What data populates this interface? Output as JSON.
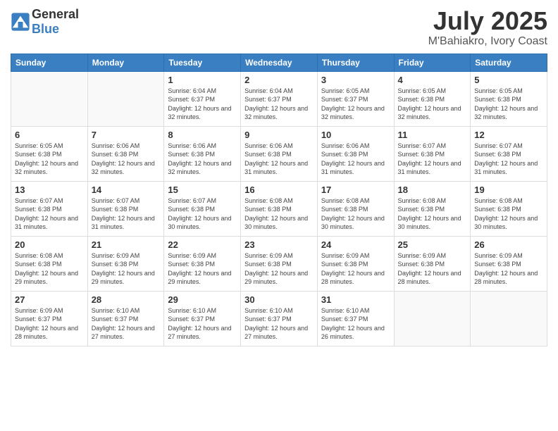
{
  "logo": {
    "general": "General",
    "blue": "Blue"
  },
  "title": "July 2025",
  "subtitle": "M'Bahiakro, Ivory Coast",
  "weekdays": [
    "Sunday",
    "Monday",
    "Tuesday",
    "Wednesday",
    "Thursday",
    "Friday",
    "Saturday"
  ],
  "weeks": [
    [
      {
        "day": "",
        "detail": ""
      },
      {
        "day": "",
        "detail": ""
      },
      {
        "day": "1",
        "detail": "Sunrise: 6:04 AM\nSunset: 6:37 PM\nDaylight: 12 hours and 32 minutes."
      },
      {
        "day": "2",
        "detail": "Sunrise: 6:04 AM\nSunset: 6:37 PM\nDaylight: 12 hours and 32 minutes."
      },
      {
        "day": "3",
        "detail": "Sunrise: 6:05 AM\nSunset: 6:37 PM\nDaylight: 12 hours and 32 minutes."
      },
      {
        "day": "4",
        "detail": "Sunrise: 6:05 AM\nSunset: 6:38 PM\nDaylight: 12 hours and 32 minutes."
      },
      {
        "day": "5",
        "detail": "Sunrise: 6:05 AM\nSunset: 6:38 PM\nDaylight: 12 hours and 32 minutes."
      }
    ],
    [
      {
        "day": "6",
        "detail": "Sunrise: 6:05 AM\nSunset: 6:38 PM\nDaylight: 12 hours and 32 minutes."
      },
      {
        "day": "7",
        "detail": "Sunrise: 6:06 AM\nSunset: 6:38 PM\nDaylight: 12 hours and 32 minutes."
      },
      {
        "day": "8",
        "detail": "Sunrise: 6:06 AM\nSunset: 6:38 PM\nDaylight: 12 hours and 32 minutes."
      },
      {
        "day": "9",
        "detail": "Sunrise: 6:06 AM\nSunset: 6:38 PM\nDaylight: 12 hours and 31 minutes."
      },
      {
        "day": "10",
        "detail": "Sunrise: 6:06 AM\nSunset: 6:38 PM\nDaylight: 12 hours and 31 minutes."
      },
      {
        "day": "11",
        "detail": "Sunrise: 6:07 AM\nSunset: 6:38 PM\nDaylight: 12 hours and 31 minutes."
      },
      {
        "day": "12",
        "detail": "Sunrise: 6:07 AM\nSunset: 6:38 PM\nDaylight: 12 hours and 31 minutes."
      }
    ],
    [
      {
        "day": "13",
        "detail": "Sunrise: 6:07 AM\nSunset: 6:38 PM\nDaylight: 12 hours and 31 minutes."
      },
      {
        "day": "14",
        "detail": "Sunrise: 6:07 AM\nSunset: 6:38 PM\nDaylight: 12 hours and 31 minutes."
      },
      {
        "day": "15",
        "detail": "Sunrise: 6:07 AM\nSunset: 6:38 PM\nDaylight: 12 hours and 30 minutes."
      },
      {
        "day": "16",
        "detail": "Sunrise: 6:08 AM\nSunset: 6:38 PM\nDaylight: 12 hours and 30 minutes."
      },
      {
        "day": "17",
        "detail": "Sunrise: 6:08 AM\nSunset: 6:38 PM\nDaylight: 12 hours and 30 minutes."
      },
      {
        "day": "18",
        "detail": "Sunrise: 6:08 AM\nSunset: 6:38 PM\nDaylight: 12 hours and 30 minutes."
      },
      {
        "day": "19",
        "detail": "Sunrise: 6:08 AM\nSunset: 6:38 PM\nDaylight: 12 hours and 30 minutes."
      }
    ],
    [
      {
        "day": "20",
        "detail": "Sunrise: 6:08 AM\nSunset: 6:38 PM\nDaylight: 12 hours and 29 minutes."
      },
      {
        "day": "21",
        "detail": "Sunrise: 6:09 AM\nSunset: 6:38 PM\nDaylight: 12 hours and 29 minutes."
      },
      {
        "day": "22",
        "detail": "Sunrise: 6:09 AM\nSunset: 6:38 PM\nDaylight: 12 hours and 29 minutes."
      },
      {
        "day": "23",
        "detail": "Sunrise: 6:09 AM\nSunset: 6:38 PM\nDaylight: 12 hours and 29 minutes."
      },
      {
        "day": "24",
        "detail": "Sunrise: 6:09 AM\nSunset: 6:38 PM\nDaylight: 12 hours and 28 minutes."
      },
      {
        "day": "25",
        "detail": "Sunrise: 6:09 AM\nSunset: 6:38 PM\nDaylight: 12 hours and 28 minutes."
      },
      {
        "day": "26",
        "detail": "Sunrise: 6:09 AM\nSunset: 6:38 PM\nDaylight: 12 hours and 28 minutes."
      }
    ],
    [
      {
        "day": "27",
        "detail": "Sunrise: 6:09 AM\nSunset: 6:37 PM\nDaylight: 12 hours and 28 minutes."
      },
      {
        "day": "28",
        "detail": "Sunrise: 6:10 AM\nSunset: 6:37 PM\nDaylight: 12 hours and 27 minutes."
      },
      {
        "day": "29",
        "detail": "Sunrise: 6:10 AM\nSunset: 6:37 PM\nDaylight: 12 hours and 27 minutes."
      },
      {
        "day": "30",
        "detail": "Sunrise: 6:10 AM\nSunset: 6:37 PM\nDaylight: 12 hours and 27 minutes."
      },
      {
        "day": "31",
        "detail": "Sunrise: 6:10 AM\nSunset: 6:37 PM\nDaylight: 12 hours and 26 minutes."
      },
      {
        "day": "",
        "detail": ""
      },
      {
        "day": "",
        "detail": ""
      }
    ]
  ]
}
